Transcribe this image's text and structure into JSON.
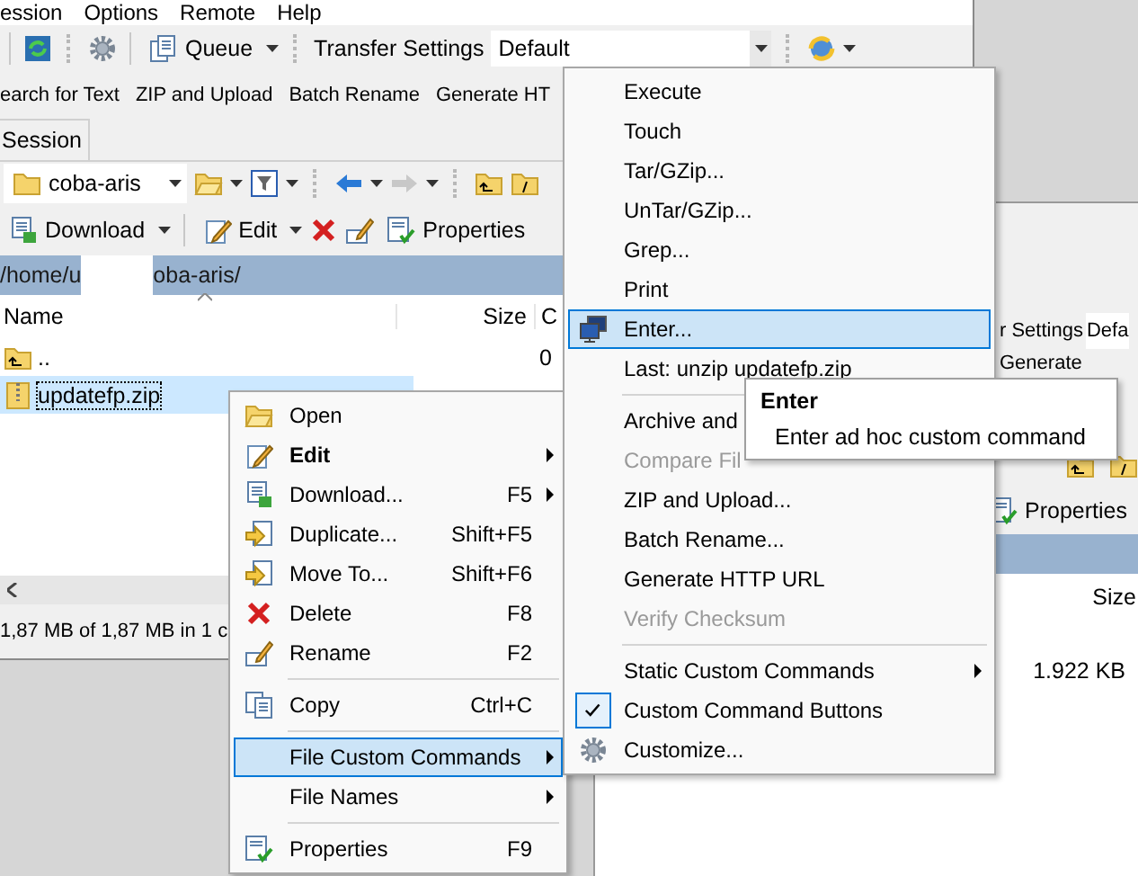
{
  "main_window": {
    "menu_bar": [
      "ession",
      "Options",
      "Remote",
      "Help"
    ],
    "toolbar": {
      "queue_label": "Queue",
      "transfer_settings_label": "Transfer Settings",
      "transfer_preset": "Default"
    },
    "custom_command_bar": [
      "earch for Text",
      "ZIP and Upload",
      "Batch Rename",
      "Generate HT"
    ],
    "tabs": [
      {
        "label": "Session",
        "selected": false
      }
    ],
    "location": "coba-aris",
    "file_toolbar": {
      "download_label": "Download",
      "edit_label": "Edit",
      "properties_label": "Properties"
    },
    "path_parts": [
      "/home/u",
      "oba-aris/"
    ],
    "columns": [
      "Name",
      "Size",
      "C"
    ],
    "rows": [
      {
        "kind": "parent",
        "name": "..",
        "column_3": "0",
        "selected": false
      },
      {
        "kind": "file",
        "name": "updatefp.zip",
        "selected": true
      }
    ],
    "status_bar": "1,87 MB of 1,87 MB in 1 c"
  },
  "back_window": {
    "transfer_settings_label": "r Settings",
    "transfer_preset": "Defa",
    "custom_command": "Generate",
    "properties_label": "Properties",
    "columns": [
      "Size"
    ],
    "rows": [
      {
        "size": "1.922 KB"
      }
    ]
  },
  "context_menu": {
    "items": [
      {
        "kind": "item",
        "label": "Open",
        "default": false,
        "submenu": false,
        "selected": false,
        "disabled": false
      },
      {
        "kind": "item",
        "label": "Edit",
        "default": true,
        "submenu": true,
        "selected": false,
        "disabled": false
      },
      {
        "kind": "item",
        "label": "Download...",
        "shortcut": "F5",
        "default": false,
        "submenu": true,
        "selected": false,
        "disabled": false
      },
      {
        "kind": "item",
        "label": "Duplicate...",
        "shortcut": "Shift+F5",
        "default": false,
        "submenu": false,
        "selected": false,
        "disabled": false
      },
      {
        "kind": "item",
        "label": "Move To...",
        "shortcut": "Shift+F6",
        "default": false,
        "submenu": false,
        "selected": false,
        "disabled": false
      },
      {
        "kind": "item",
        "label": "Delete",
        "shortcut": "F8",
        "default": false,
        "submenu": false,
        "selected": false,
        "disabled": false
      },
      {
        "kind": "item",
        "label": "Rename",
        "shortcut": "F2",
        "default": false,
        "submenu": false,
        "selected": false,
        "disabled": false
      },
      {
        "kind": "separator"
      },
      {
        "kind": "item",
        "label": "Copy",
        "shortcut": "Ctrl+C",
        "default": false,
        "submenu": false,
        "selected": false,
        "disabled": false
      },
      {
        "kind": "separator"
      },
      {
        "kind": "item",
        "label": "File Custom Commands",
        "default": false,
        "submenu": true,
        "selected": true,
        "disabled": false
      },
      {
        "kind": "item",
        "label": "File Names",
        "default": false,
        "submenu": true,
        "selected": false,
        "disabled": false
      },
      {
        "kind": "separator"
      },
      {
        "kind": "item",
        "label": "Properties",
        "shortcut": "F9",
        "default": false,
        "submenu": false,
        "selected": false,
        "disabled": false
      }
    ]
  },
  "custom_commands_menu": {
    "items": [
      {
        "kind": "item",
        "label": "Execute",
        "selected": false,
        "disabled": false,
        "checked": false
      },
      {
        "kind": "item",
        "label": "Touch",
        "selected": false,
        "disabled": false,
        "checked": false
      },
      {
        "kind": "item",
        "label": "Tar/GZip...",
        "selected": false,
        "disabled": false,
        "checked": false
      },
      {
        "kind": "item",
        "label": "UnTar/GZip...",
        "selected": false,
        "disabled": false,
        "checked": false
      },
      {
        "kind": "item",
        "label": "Grep...",
        "selected": false,
        "disabled": false,
        "checked": false
      },
      {
        "kind": "item",
        "label": "Print",
        "selected": false,
        "disabled": false,
        "checked": false
      },
      {
        "kind": "item",
        "label": "Enter...",
        "selected": true,
        "disabled": false,
        "checked": false
      },
      {
        "kind": "item",
        "label": "Last: unzip updatefp.zip",
        "selected": false,
        "disabled": false,
        "checked": false
      },
      {
        "kind": "separator"
      },
      {
        "kind": "item",
        "label": "Archive and",
        "selected": false,
        "disabled": false,
        "checked": false
      },
      {
        "kind": "item",
        "label": "Compare Fil",
        "selected": false,
        "disabled": true,
        "checked": false
      },
      {
        "kind": "item",
        "label": "ZIP and Upload...",
        "selected": false,
        "disabled": false,
        "checked": false
      },
      {
        "kind": "item",
        "label": "Batch Rename...",
        "selected": false,
        "disabled": false,
        "checked": false
      },
      {
        "kind": "item",
        "label": "Generate HTTP URL",
        "selected": false,
        "disabled": false,
        "checked": false
      },
      {
        "kind": "item",
        "label": "Verify Checksum",
        "selected": false,
        "disabled": true,
        "checked": false
      },
      {
        "kind": "separator"
      },
      {
        "kind": "submenu",
        "label": "Static Custom Commands",
        "selected": false,
        "disabled": false,
        "checked": false
      },
      {
        "kind": "item",
        "label": "Custom Command Buttons",
        "selected": false,
        "disabled": false,
        "checked": true
      },
      {
        "kind": "item",
        "label": "Customize...",
        "selected": false,
        "disabled": false,
        "checked": false
      }
    ]
  },
  "tooltip": {
    "title": "Enter",
    "text": "Enter ad hoc custom command"
  }
}
